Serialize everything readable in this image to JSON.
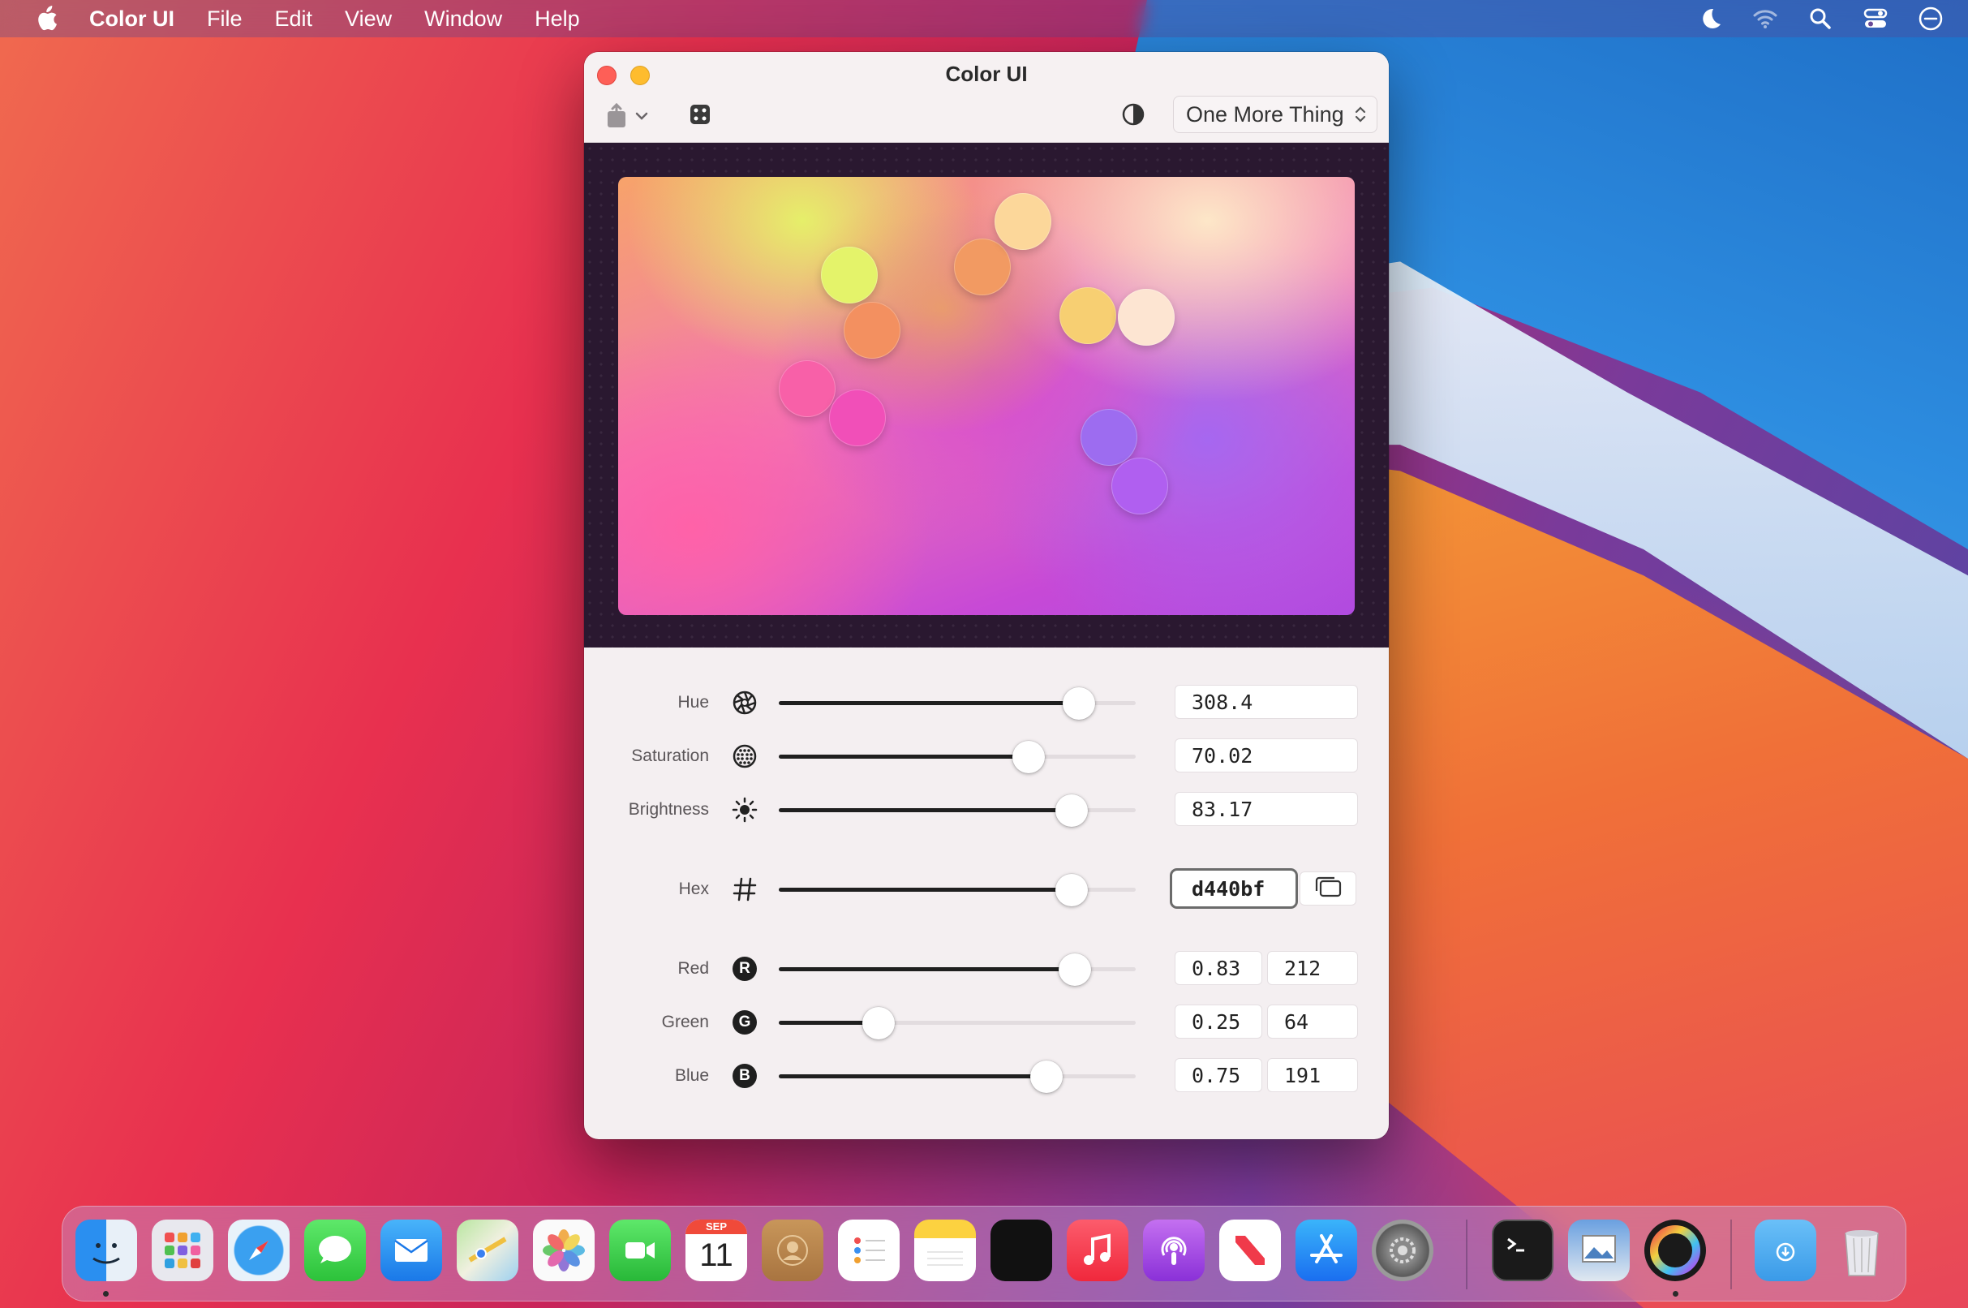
{
  "menubar": {
    "app_name": "Color UI",
    "items": [
      "File",
      "Edit",
      "View",
      "Window",
      "Help"
    ]
  },
  "window": {
    "title": "Color UI",
    "scheme_selected": "One More Thing"
  },
  "controls": {
    "hue": {
      "label": "Hue",
      "value": "308.4",
      "fraction": 0.84
    },
    "saturation": {
      "label": "Saturation",
      "value": "70.02",
      "fraction": 0.7
    },
    "brightness": {
      "label": "Brightness",
      "value": "83.17",
      "fraction": 0.82
    },
    "hex": {
      "label": "Hex",
      "value": "d440bf",
      "fraction": 0.82
    },
    "red": {
      "label": "Red",
      "badge": "R",
      "value": "0.83",
      "int": "212",
      "fraction": 0.83
    },
    "green": {
      "label": "Green",
      "badge": "G",
      "value": "0.25",
      "int": "64",
      "fraction": 0.28
    },
    "blue": {
      "label": "Blue",
      "badge": "B",
      "value": "0.75",
      "int": "191",
      "fraction": 0.75
    }
  },
  "dock": {
    "calendar_month": "SEP",
    "calendar_day": "11"
  },
  "colors": {
    "current": "#d440bf",
    "close": "#fe5f57",
    "minimize": "#febc2e"
  }
}
